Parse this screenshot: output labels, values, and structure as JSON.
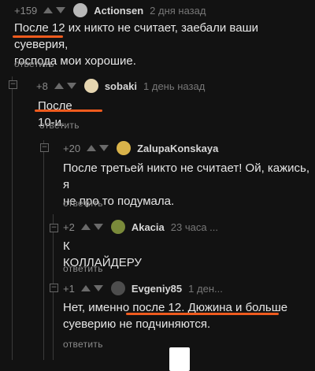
{
  "comments": [
    {
      "rating": "+159",
      "author": "Actionsen",
      "time": "2 дня назад",
      "text_lines": [
        "После 12 их никто не считает, заебали ваши суеверия,",
        "господа мои хорошие."
      ],
      "reply": "ответить",
      "avatar_color": "#b9b9b9"
    },
    {
      "rating": "+8",
      "author": "sobaki",
      "time": "1 день назад",
      "text_lines": [
        "После 10-и."
      ],
      "reply": "ответить",
      "avatar_color": "#e6d6b0"
    },
    {
      "rating": "+20",
      "author": "ZalupaKonskaya",
      "time": "",
      "text_lines": [
        "После третьей никто не считает! Ой, кажись, я",
        "не про то подумала."
      ],
      "reply": "ответить",
      "avatar_color": "#d9b34a"
    },
    {
      "rating": "+2",
      "author": "Akacia",
      "time": "23 часа ...",
      "text_lines": [
        "К КОЛЛАЙДЕРУ"
      ],
      "reply": "ответить",
      "avatar_color": "#7a8a3a"
    },
    {
      "rating": "+1",
      "author": "Evgeniy85",
      "time": "1 ден...",
      "text_lines": [
        "Нет, именно после 12. Дюжина и больше",
        "суеверию не подчиняются."
      ],
      "reply": "ответить",
      "avatar_color": "#4d4d4d"
    }
  ],
  "collapse_symbol": "−",
  "highlight_color": "#ef5b1e"
}
